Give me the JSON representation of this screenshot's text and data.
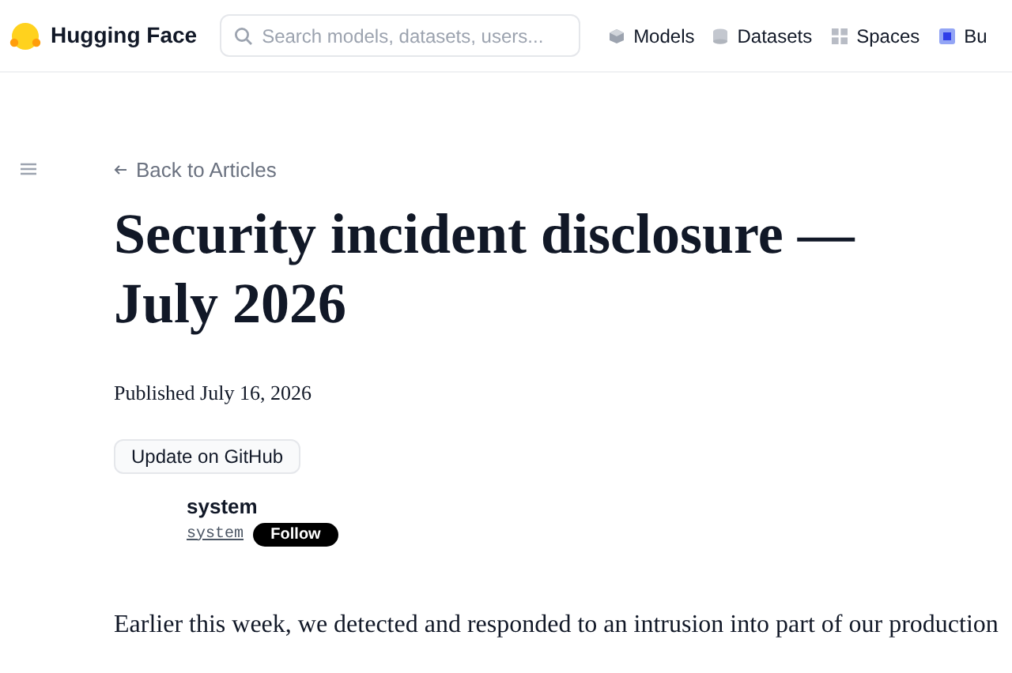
{
  "header": {
    "brand": "Hugging Face",
    "search": {
      "placeholder": "Search models, datasets, users..."
    },
    "nav": [
      {
        "label": "Models",
        "kind": "models"
      },
      {
        "label": "Datasets",
        "kind": "datasets"
      },
      {
        "label": "Spaces",
        "kind": "spaces"
      },
      {
        "label": "Bu",
        "kind": "buckets"
      }
    ]
  },
  "article": {
    "back": "Back to Articles",
    "title": "Security incident disclosure — July 2026",
    "published": "Published July 16, 2026",
    "github_button": "Update on GitHub",
    "author": {
      "name": "system",
      "handle": "system",
      "follow": "Follow"
    },
    "paragraph": "Earlier this week, we detected and responded to an intrusion into part of our production"
  }
}
